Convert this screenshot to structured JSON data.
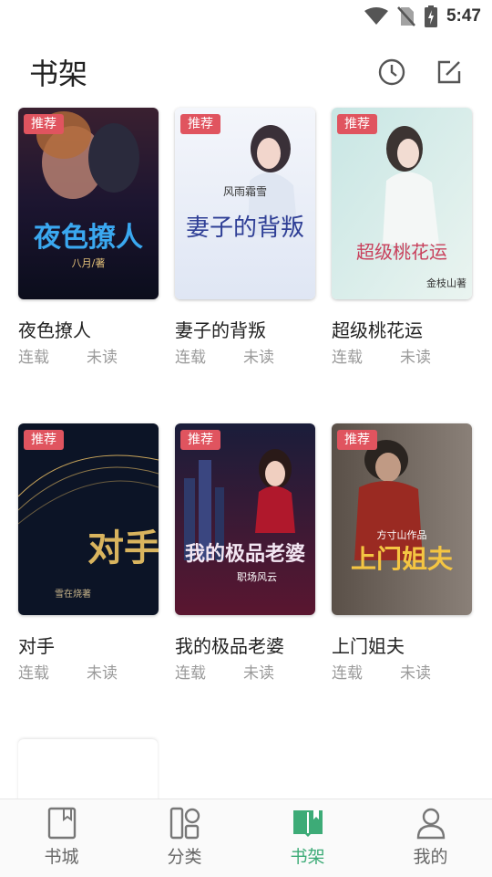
{
  "status_bar": {
    "time": "5:47",
    "icons": [
      "wifi-icon",
      "no-sim-icon",
      "battery-icon"
    ]
  },
  "header": {
    "title": "书架",
    "icons": [
      "history-icon",
      "edit-icon"
    ]
  },
  "tag_label": "推荐",
  "books": [
    {
      "title": "夜色撩人",
      "status": "连载",
      "read_state": "未读",
      "tagged": true,
      "cover_text": "夜色撩人",
      "cover_author": "八月/著"
    },
    {
      "title": "妻子的背叛",
      "status": "连载",
      "read_state": "未读",
      "tagged": true,
      "cover_text": "妻子的背叛",
      "cover_author": "风雨霜雪"
    },
    {
      "title": "超级桃花运",
      "status": "连载",
      "read_state": "未读",
      "tagged": true,
      "cover_text": "超级桃花运",
      "cover_author": "金枝山著"
    },
    {
      "title": "对手",
      "status": "连载",
      "read_state": "未读",
      "tagged": true,
      "cover_text": "对手",
      "cover_author": "雪在烧著"
    },
    {
      "title": "我的极品老婆",
      "status": "连载",
      "read_state": "未读",
      "tagged": true,
      "cover_text": "我的极品老婆",
      "cover_author": "职场风云"
    },
    {
      "title": "上门姐夫",
      "status": "连载",
      "read_state": "未读",
      "tagged": true,
      "cover_text": "上门姐夫",
      "cover_author": "方寸山作品"
    }
  ],
  "tabs": [
    {
      "label": "书城",
      "icon": "bookstore-icon",
      "active": false
    },
    {
      "label": "分类",
      "icon": "category-icon",
      "active": false
    },
    {
      "label": "书架",
      "icon": "bookshelf-icon",
      "active": true
    },
    {
      "label": "我的",
      "icon": "profile-icon",
      "active": false
    }
  ],
  "colors": {
    "accent": "#3dab77",
    "tag": "#e0545f",
    "meta": "#9a9a9a"
  }
}
